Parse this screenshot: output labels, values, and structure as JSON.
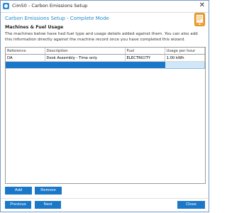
{
  "window": {
    "title": "Cim50 - Carbon Emissions Setup",
    "close_glyph": "✕"
  },
  "header": {
    "title": "Carbon Emissions Setup - Complete Mode"
  },
  "section": {
    "title": "Machines & Fuel Usage",
    "description": "The machines below have had fuel type and usage details added against them. You can also add this information directly against the machine record once you have completed this wizard."
  },
  "table": {
    "columns": [
      "Reference",
      "Description",
      "Fuel",
      "Usage per hour"
    ],
    "rows": [
      [
        "DA",
        "Desk Assembly - Time only",
        "ELECTRICITY",
        "1.00 kWh"
      ]
    ]
  },
  "buttons": {
    "add": "Add",
    "remove": "Remove",
    "previous": "Previous",
    "next": "Next",
    "close": "Close"
  },
  "colors": {
    "accent": "#1b78c9",
    "header_text": "#1f8bd0"
  }
}
